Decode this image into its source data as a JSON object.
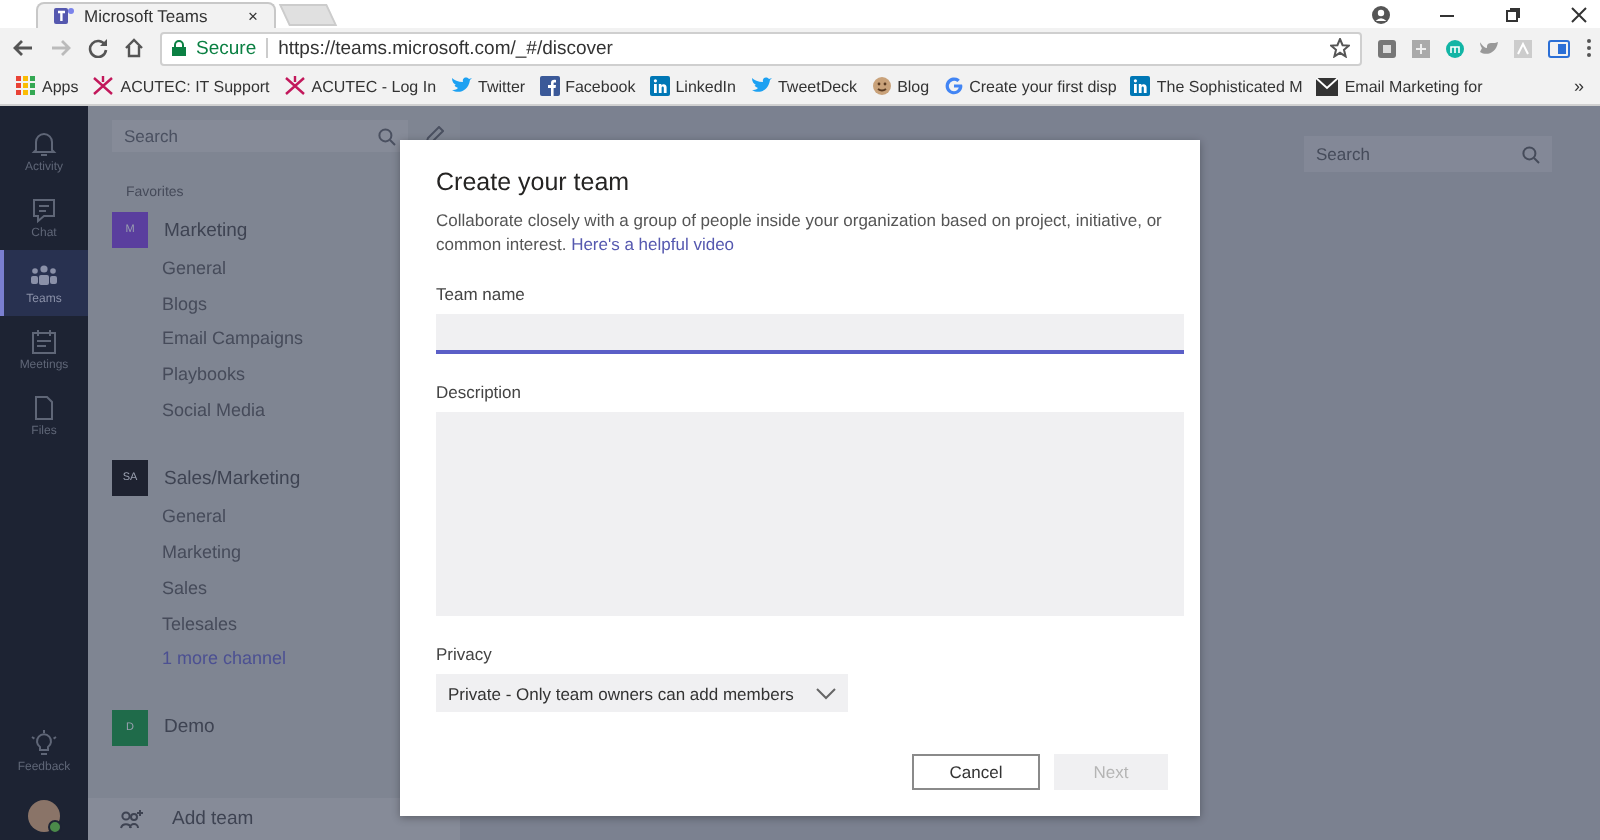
{
  "browser": {
    "tab": {
      "title": "Microsoft Teams",
      "close": "×"
    },
    "security": "Secure",
    "url": "https://teams.microsoft.com/_#/discover",
    "bookmarks": [
      {
        "label": "Apps",
        "kind": "apps"
      },
      {
        "label": "ACUTEC: IT Support",
        "kind": "spark"
      },
      {
        "label": "ACUTEC - Log In",
        "kind": "spark"
      },
      {
        "label": "Twitter",
        "kind": "bird"
      },
      {
        "label": "Facebook",
        "kind": "facebook"
      },
      {
        "label": "LinkedIn",
        "kind": "linkedin"
      },
      {
        "label": "TweetDeck",
        "kind": "bird"
      },
      {
        "label": "Blog",
        "kind": "face"
      },
      {
        "label": "Create your first disp",
        "kind": "google"
      },
      {
        "label": "The Sophisticated M",
        "kind": "linkedin"
      },
      {
        "label": "Email Marketing for",
        "kind": "mail"
      }
    ],
    "overflow": "»"
  },
  "rail": {
    "items": [
      {
        "label": "Activity",
        "kind": "bell",
        "selected": false
      },
      {
        "label": "Chat",
        "kind": "chat",
        "selected": false
      },
      {
        "label": "Teams",
        "kind": "teams",
        "selected": true
      },
      {
        "label": "Meetings",
        "kind": "calendar",
        "selected": false
      },
      {
        "label": "Files",
        "kind": "file",
        "selected": false
      }
    ],
    "feedback": "Feedback"
  },
  "teams_panel": {
    "search": {
      "placeholder": "Search"
    },
    "section": "Favorites",
    "teams": [
      {
        "initials": "M",
        "name": "Marketing",
        "color": "#5a3e9e",
        "channels": [
          {
            "label": "General",
            "kind": "channel"
          },
          {
            "label": "Blogs",
            "kind": "channel"
          },
          {
            "label": "Email Campaigns",
            "kind": "channel"
          },
          {
            "label": "Playbooks",
            "kind": "channel"
          },
          {
            "label": "Social Media",
            "kind": "channel"
          }
        ]
      },
      {
        "initials": "SA",
        "name": "Sales/Marketing",
        "color": "#1e2230",
        "channels": [
          {
            "label": "General",
            "kind": "channel"
          },
          {
            "label": "Marketing",
            "kind": "channel"
          },
          {
            "label": "Sales",
            "kind": "channel"
          },
          {
            "label": "Telesales",
            "kind": "channel"
          },
          {
            "label": "1 more channel",
            "kind": "more"
          }
        ]
      },
      {
        "initials": "D",
        "name": "Demo",
        "color": "#1f6b4a"
      }
    ],
    "add_team": "Add team"
  },
  "main": {
    "search": {
      "placeholder": "Search"
    }
  },
  "dialog": {
    "title": "Create your team",
    "description": "Collaborate closely with a group of people inside your organization based on project, initiative, or common interest.",
    "link": "Here's a helpful video",
    "fields": [
      {
        "label": "Team name",
        "kind": "input",
        "focused": true
      },
      {
        "label": "Description",
        "kind": "textarea",
        "focused": false
      }
    ],
    "privacy": {
      "label": "Privacy",
      "value": "Private - Only team owners can add members"
    },
    "buttons": [
      {
        "label": "Cancel",
        "disabled": false
      },
      {
        "label": "Next",
        "disabled": true
      }
    ]
  }
}
